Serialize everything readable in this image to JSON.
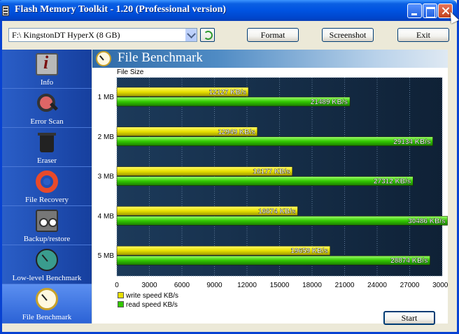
{
  "window": {
    "title": "Flash Memory Toolkit - 1.20 (Professional version)"
  },
  "toolbar": {
    "drive": "F:\\ KingstonDT HyperX (8 GB)",
    "format_label": "Format",
    "screenshot_label": "Screenshot",
    "exit_label": "Exit"
  },
  "sidebar": {
    "items": [
      {
        "label": "Info",
        "icon": "info-icon"
      },
      {
        "label": "Error Scan",
        "icon": "magnifier-icon"
      },
      {
        "label": "Eraser",
        "icon": "trash-bin-icon"
      },
      {
        "label": "File Recovery",
        "icon": "lifebuoy-icon"
      },
      {
        "label": "Backup/restore",
        "icon": "tape-icon"
      },
      {
        "label": "Low-level Benchmark",
        "icon": "stopwatch-icon"
      },
      {
        "label": "File Benchmark",
        "icon": "stopwatch-icon"
      }
    ],
    "active_index": 6
  },
  "panel": {
    "title": "File Benchmark"
  },
  "footer": {
    "start_label": "Start"
  },
  "chart_data": {
    "type": "bar",
    "orientation": "horizontal",
    "title": "",
    "ylabel": "File Size",
    "xlabel": "",
    "categories": [
      "1 MB",
      "2 MB",
      "3 MB",
      "4 MB",
      "5 MB"
    ],
    "series": [
      {
        "name": "write speed KB/s",
        "values": [
          12127,
          12949,
          16177,
          16674,
          19659
        ],
        "color": "#e8e000",
        "value_labels": [
          "12127 KB/s",
          "12949 KB/s",
          "16177 KB/s",
          "16674 KB/s",
          "19659 KB/s"
        ]
      },
      {
        "name": "read speed KB/s",
        "values": [
          21489,
          29134,
          27312,
          30486,
          28874
        ],
        "color": "#32c800",
        "value_labels": [
          "21489 KB/s",
          "29134 KB/s",
          "27312 KB/s",
          "30486 KB/s",
          "28874 KB/s"
        ]
      }
    ],
    "xlim": [
      0,
      30000
    ],
    "xticks": [
      "0",
      "3000",
      "6000",
      "9000",
      "12000",
      "15000",
      "18000",
      "21000",
      "24000",
      "27000",
      "30000"
    ],
    "grid": true,
    "legend_position": "bottom-left",
    "background_color": "#1a3550"
  }
}
